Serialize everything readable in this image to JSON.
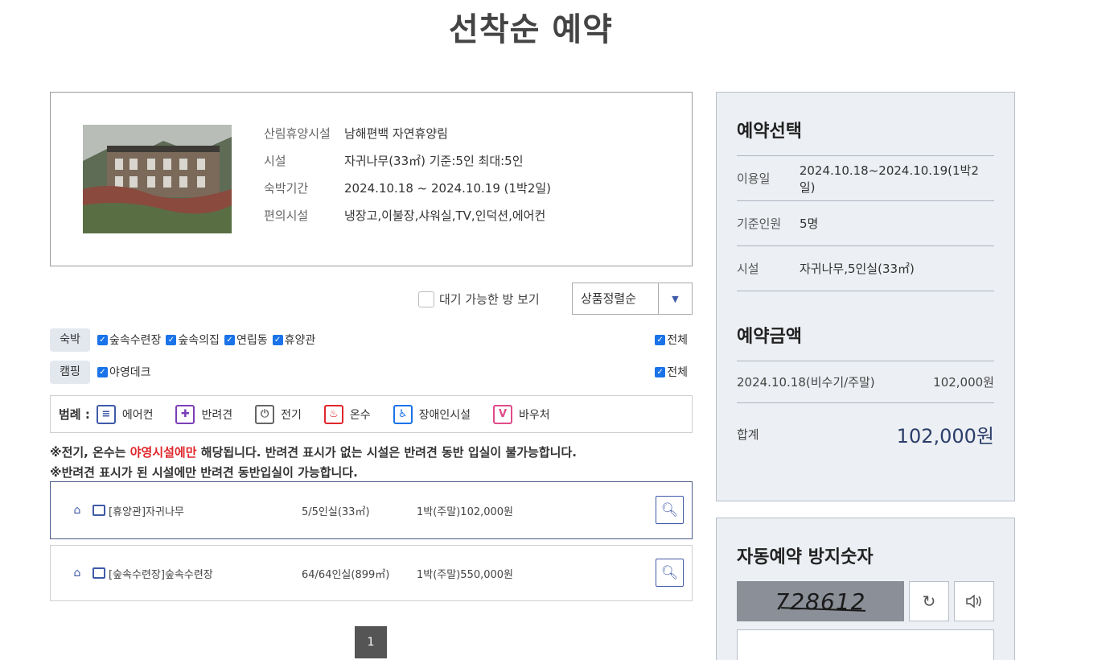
{
  "page": {
    "title": "선착순 예약"
  },
  "facility": {
    "rows": [
      {
        "label": "산림휴양시설",
        "value": "남해편백 자연휴양림"
      },
      {
        "label": "시설",
        "value": "자귀나무(33㎡) 기준:5인 최대:5인"
      },
      {
        "label": "숙박기간",
        "value": "2024.10.18 ~ 2024.10.19 (1박2일)"
      },
      {
        "label": "편의시설",
        "value": "냉장고,이불장,샤워실,TV,인덕션,에어컨"
      }
    ]
  },
  "filters": {
    "wait_label": "대기 가능한 방 보기",
    "sort_label": "상품정렬순",
    "lodging": {
      "tag": "숙박",
      "options": [
        "숲속수련장",
        "숲속의집",
        "연립동",
        "휴양관"
      ],
      "all": "전체"
    },
    "camping": {
      "tag": "캠핑",
      "options": [
        "야영데크"
      ],
      "all": "전체"
    }
  },
  "legend": {
    "title": "범례 :",
    "items": [
      {
        "label": "에어컨",
        "icon": "air-conditioner-icon",
        "color": "#3f5aa8",
        "glyph": "≡"
      },
      {
        "label": "반려견",
        "icon": "dog-icon",
        "color": "#7b3fb8",
        "glyph": "🐕"
      },
      {
        "label": "전기",
        "icon": "plug-icon",
        "color": "#666666",
        "glyph": "⏻"
      },
      {
        "label": "온수",
        "icon": "hot-water-icon",
        "color": "#e0262c",
        "glyph": "♨"
      },
      {
        "label": "장애인시설",
        "icon": "wheelchair-icon",
        "color": "#1a73e8",
        "glyph": "♿"
      },
      {
        "label": "바우처",
        "icon": "voucher-icon",
        "color": "#e04b8a",
        "glyph": "V"
      }
    ]
  },
  "notice": {
    "line1_pre": "※전기, 온수는 ",
    "line1_red": "야영시설에만",
    "line1_post": " 해당됩니다. 반려견 표시가 없는 시설은 반려견 동반 입실이 불가능합니다.",
    "line2": "※반려견 표시가 된 시설에만 반려견 동반입실이 가능합니다."
  },
  "rooms": [
    {
      "name": "[휴양관]자귀나무",
      "capacity": "5/5인실(33㎡)",
      "price": "1박(주말)102,000원"
    },
    {
      "name": "[숲속수련장]숲속수련장",
      "capacity": "64/64인실(899㎡)",
      "price": "1박(주말)550,000원"
    }
  ],
  "pagination": {
    "current": "1"
  },
  "summary": {
    "heading": "예약선택",
    "rows": [
      {
        "key": "이용일",
        "value": "2024.10.18~2024.10.19(1박2일)"
      },
      {
        "key": "기준인원",
        "value": "5명"
      },
      {
        "key": "시설",
        "value": "자귀나무,5인실(33㎡)"
      }
    ],
    "price_heading": "예약금액",
    "price_line": {
      "date": "2024.10.18(비수기/주말)",
      "amount": "102,000원"
    },
    "total_label": "합계",
    "total_value": "102,000원"
  },
  "captcha": {
    "title": "자동예약 방지숫자",
    "code": "728612"
  }
}
